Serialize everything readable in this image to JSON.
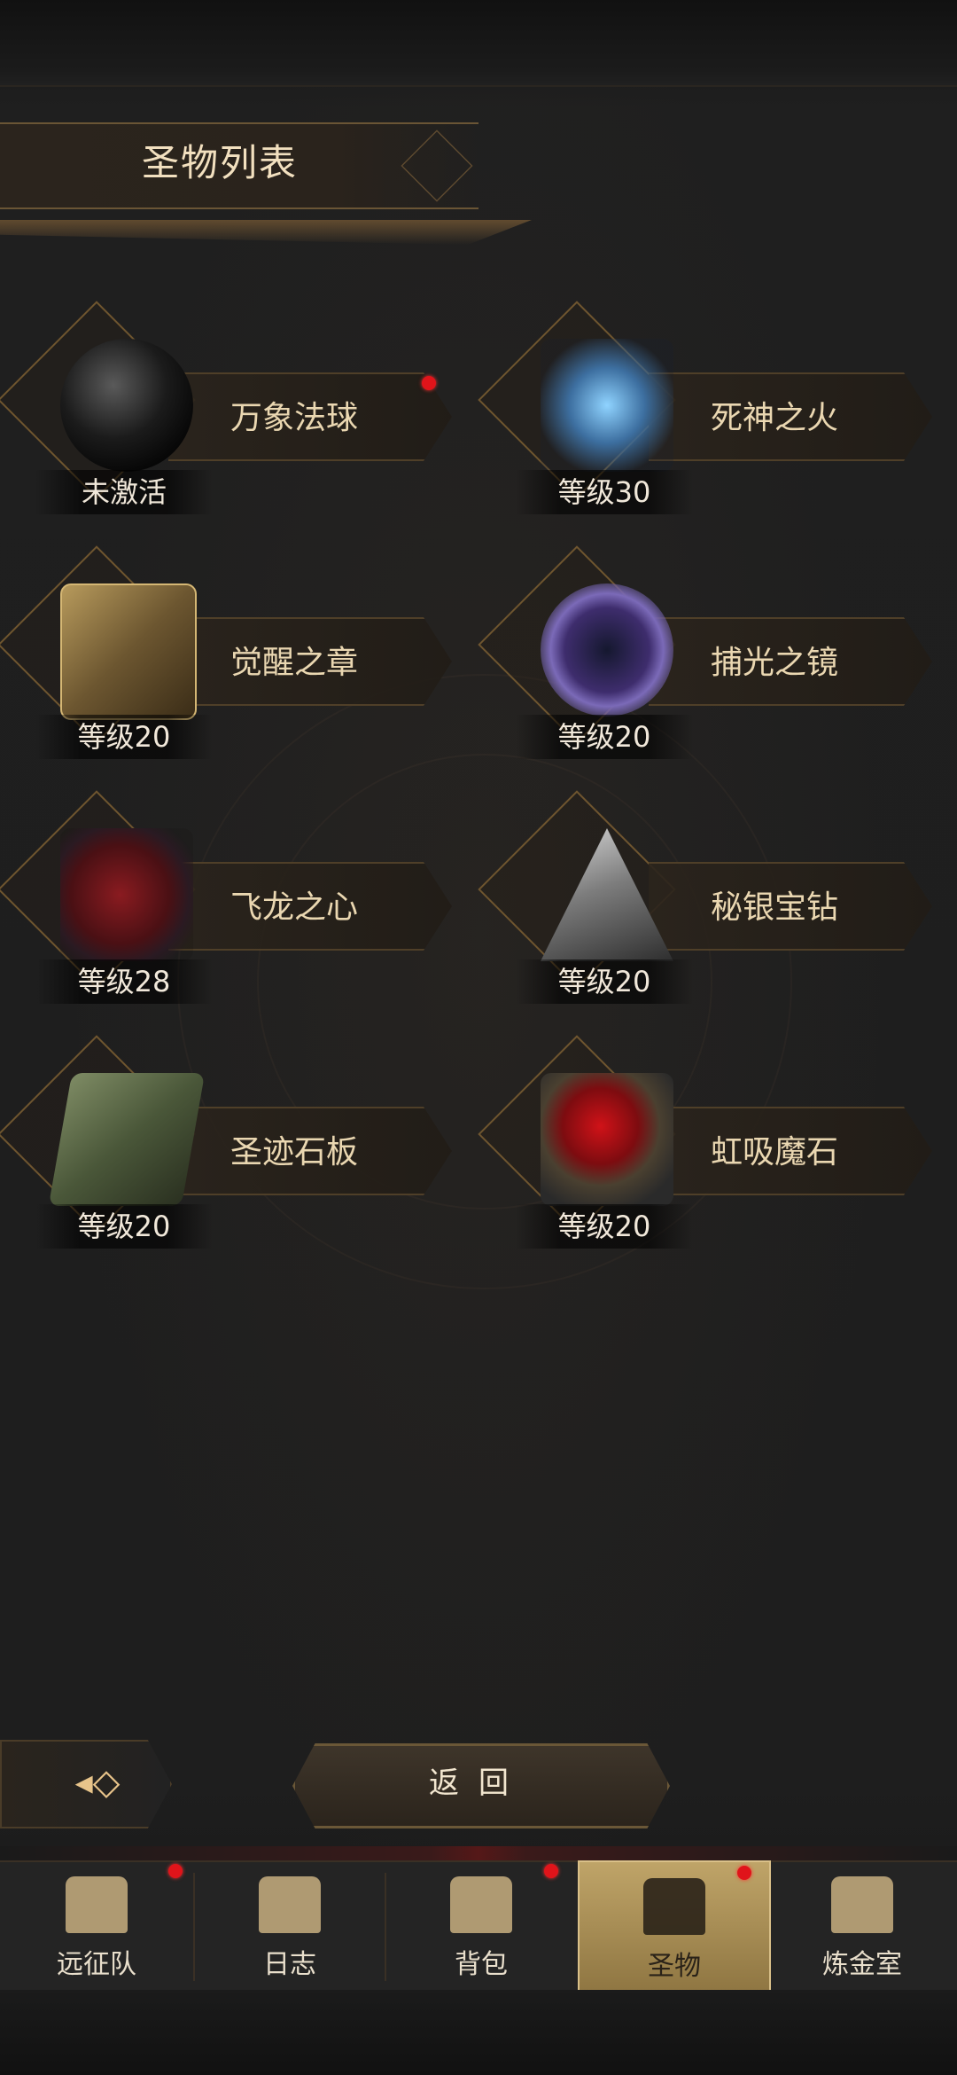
{
  "header": {
    "title": "圣物列表"
  },
  "relics": [
    {
      "name": "万象法球",
      "status": "未激活",
      "icon": "black-orb-icon",
      "has_dot": true
    },
    {
      "name": "死神之火",
      "status": "等级30",
      "icon": "spectral-claw-icon",
      "has_dot": false
    },
    {
      "name": "觉醒之章",
      "status": "等级20",
      "icon": "ancient-book-icon",
      "has_dot": false
    },
    {
      "name": "捕光之镜",
      "status": "等级20",
      "icon": "crystal-mirror-icon",
      "has_dot": false
    },
    {
      "name": "飞龙之心",
      "status": "等级28",
      "icon": "dragon-heart-icon",
      "has_dot": false
    },
    {
      "name": "秘银宝钻",
      "status": "等级20",
      "icon": "mithril-pyramid-icon",
      "has_dot": false
    },
    {
      "name": "圣迹石板",
      "status": "等级20",
      "icon": "stone-slab-icon",
      "has_dot": false
    },
    {
      "name": "虹吸魔石",
      "status": "等级20",
      "icon": "siphon-stone-icon",
      "has_dot": false
    }
  ],
  "back_button": {
    "label": "返回"
  },
  "nav": {
    "items": [
      {
        "label": "远征队",
        "icon": "viking-helmet-icon",
        "has_dot": true
      },
      {
        "label": "日志",
        "icon": "scroll-icon",
        "has_dot": false
      },
      {
        "label": "背包",
        "icon": "backpack-icon",
        "has_dot": true
      },
      {
        "label": "圣物",
        "icon": "torch-icon",
        "has_dot": true,
        "active": true
      },
      {
        "label": "炼金室",
        "icon": "alchemy-icon",
        "has_dot": false
      }
    ]
  },
  "colors": {
    "accent_gold": "#bfa468",
    "notification_red": "#e0141a",
    "text_light": "#ead7b1"
  }
}
